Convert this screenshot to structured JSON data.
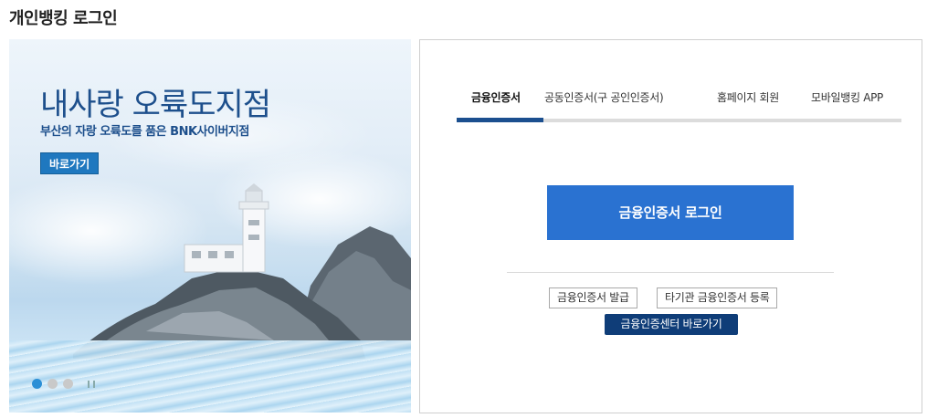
{
  "page": {
    "title": "개인뱅킹 로그인"
  },
  "banner": {
    "title": "내사랑 오륙도지점",
    "subtitle": "부산의 자랑 오륙도를 품은 BNK사이버지점",
    "button_label": "바로가기",
    "slides_total": 3,
    "active_slide": 1
  },
  "tabs": [
    {
      "label": "금융인증서",
      "active": true
    },
    {
      "label": "공동인증서(구 공인인증서)",
      "active": false
    },
    {
      "label": "홈페이지 회원",
      "active": false
    },
    {
      "label": "모바일뱅킹 APP",
      "active": false
    }
  ],
  "login": {
    "main_button": "금융인증서 로그인",
    "issue_button": "금융인증서 발급",
    "register_button": "타기관 금융인증서 등록",
    "center_button": "금융인증센터 바로가기"
  },
  "colors": {
    "primary_blue": "#2a72d1",
    "dark_navy": "#0f3d78",
    "tab_active": "#1b4f8f",
    "banner_text": "#1d4f8c"
  }
}
